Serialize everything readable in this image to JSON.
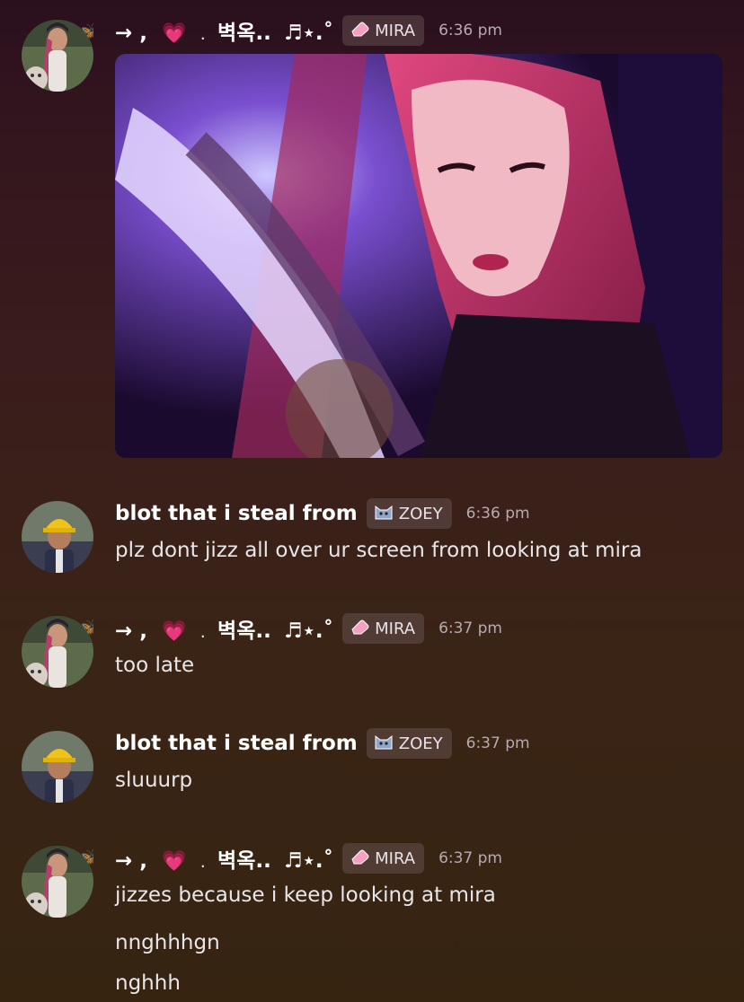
{
  "messages": [
    {
      "author": "→ , 💗 . 벽옥.. ♬⋆.˚",
      "author_parts": {
        "arrow": "→ ,",
        "heart": "💗",
        "dot": ".",
        "korean": "벽옥..",
        "notes": "♬⋆.˚"
      },
      "tag": "MIRA",
      "tag_icon": "pink-eraser-icon",
      "time": "6:36 pm",
      "attachment": "image"
    },
    {
      "author": "blot that i steal from",
      "tag": "ZOEY",
      "tag_icon": "cat-face-icon",
      "time": "6:36 pm",
      "lines": [
        "plz dont jizz all over ur screen from looking at mira"
      ]
    },
    {
      "author": "→ , 💗 . 벽옥.. ♬⋆.˚",
      "author_parts": {
        "arrow": "→ ,",
        "heart": "💗",
        "dot": ".",
        "korean": "벽옥..",
        "notes": "♬⋆.˚"
      },
      "tag": "MIRA",
      "tag_icon": "pink-eraser-icon",
      "time": "6:37 pm",
      "lines": [
        "too late"
      ]
    },
    {
      "author": "blot that i steal from",
      "tag": "ZOEY",
      "tag_icon": "cat-face-icon",
      "time": "6:37 pm",
      "lines": [
        "sluuurp"
      ]
    },
    {
      "author": "→ , 💗 . 벽옥.. ♬⋆.˚",
      "author_parts": {
        "arrow": "→ ,",
        "heart": "💗",
        "dot": ".",
        "korean": "벽옥..",
        "notes": "♬⋆.˚"
      },
      "tag": "MIRA",
      "tag_icon": "pink-eraser-icon",
      "time": "6:37 pm",
      "lines": [
        "jizzes because i keep looking at mira",
        "nnghhhgn",
        "nghhh"
      ]
    }
  ],
  "colors": {
    "background_top": "#2a0f1d",
    "background_bottom": "#362411",
    "tag_bg": "#5a4848",
    "timestamp": "#b7aab0"
  }
}
